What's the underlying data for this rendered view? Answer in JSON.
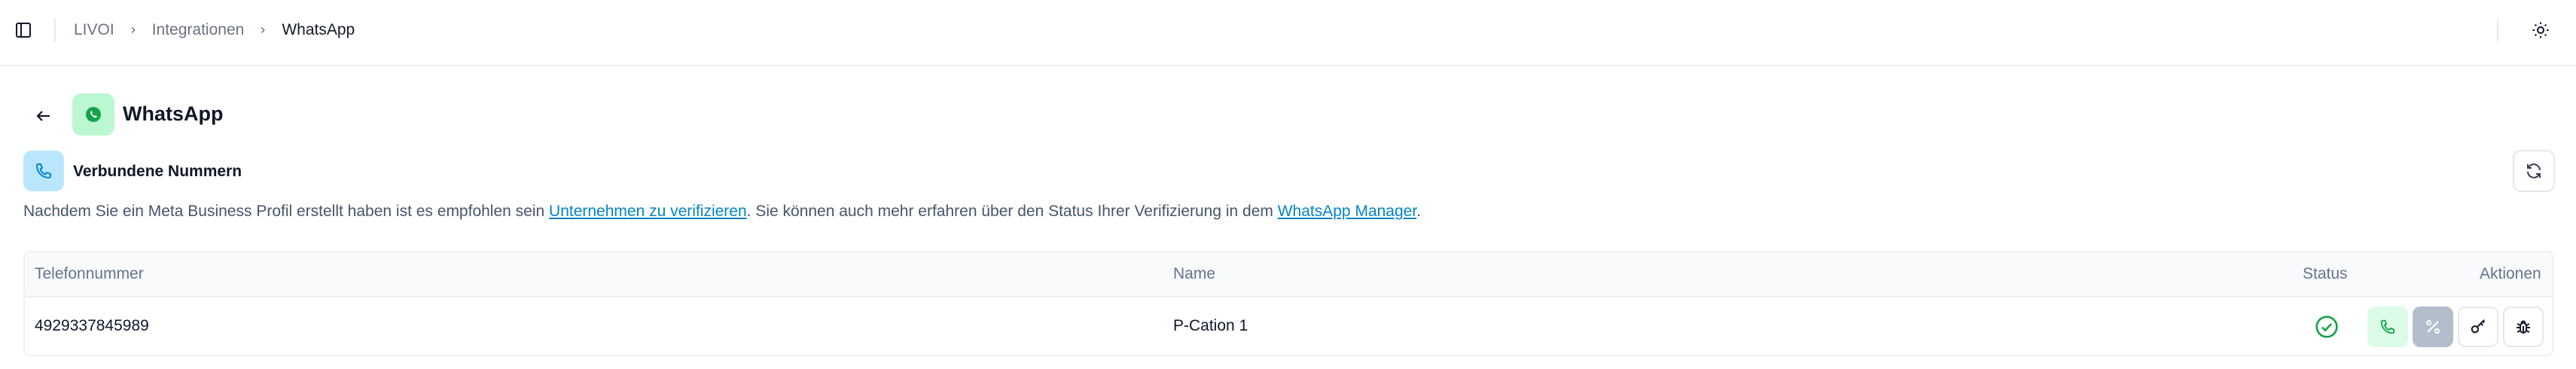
{
  "breadcrumb": {
    "items": [
      "LIVOI",
      "Integrationen"
    ],
    "current": "WhatsApp"
  },
  "page": {
    "title": "WhatsApp"
  },
  "section": {
    "title": "Verbundene Nummern",
    "info_part1": "Nachdem Sie ein Meta Business Profil erstellt haben ist es empfohlen sein ",
    "info_link1": "Unternehmen zu verifizieren",
    "info_part2": ". Sie können auch mehr erfahren über den Status Ihrer Verifizierung in dem ",
    "info_link2": "WhatsApp Manager",
    "info_part3": "."
  },
  "table": {
    "columns": {
      "phone": "Telefonnummer",
      "name": "Name",
      "status": "Status",
      "actions": "Aktionen"
    },
    "rows": [
      {
        "phone": "4929337845989",
        "name": "P-Cation 1",
        "status": "verified"
      }
    ]
  },
  "icons": {
    "sidebar_toggle": "sidebar-icon",
    "theme_toggle": "sun-icon",
    "back": "arrow-left-icon",
    "app": "whatsapp-icon",
    "section": "phone-icon",
    "refresh": "refresh-icon",
    "status": "check-circle-icon",
    "actions": [
      "phone-icon",
      "percent-icon",
      "key-icon",
      "bug-icon"
    ]
  },
  "colors": {
    "link": "#0284c7",
    "whatsapp_bg": "#bbf7d0",
    "section_icon_bg": "#bae6fd",
    "status_ok": "#16a34a"
  }
}
